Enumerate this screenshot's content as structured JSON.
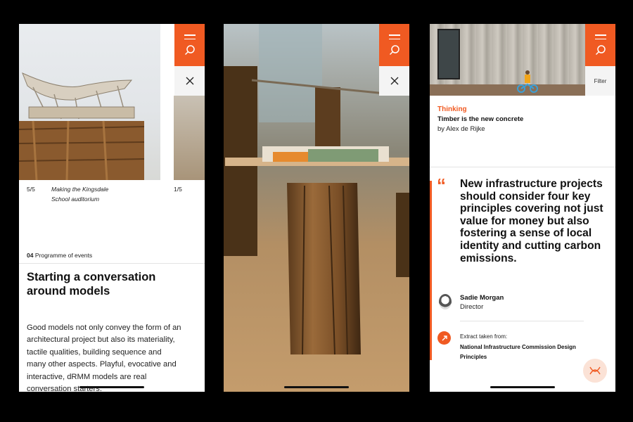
{
  "phone1": {
    "slide_counter": "5/5",
    "slide_caption_line1": "Making the Kingsdale",
    "slide_caption_line2": "School auditorium",
    "next_counter": "1/5",
    "section_number": "04",
    "section_label": "Programme of events",
    "title": "Starting a conversation around models",
    "body": "Good models not only convey the form of an architectural project but also its materiality, tactile qualities, building sequence and many other aspects. Playful, evocative and interactive, dRMM models are real conversation starters."
  },
  "phone3": {
    "kicker": "Thinking",
    "headline": "Timber is the new concrete",
    "author": "by Alex de Rijke",
    "filter_label": "Filter",
    "quote_mark": "“",
    "quote": "New infrastructure projects should consider four key principles covering not just value for money but also fostering a sense of local identity and cutting carbon emissions.",
    "person_name": "Sadie Morgan",
    "person_role": "Director",
    "source_label": "Extract taken from:",
    "source_title": "National Infrastructure Commission Design Principles"
  },
  "icons": {
    "menu": "hamburger-icon",
    "search": "search-icon",
    "close": "close-icon",
    "arrow": "arrow-icon",
    "logo": "drmm-logo-icon"
  },
  "colors": {
    "accent": "#f05a22",
    "background": "#000000"
  }
}
